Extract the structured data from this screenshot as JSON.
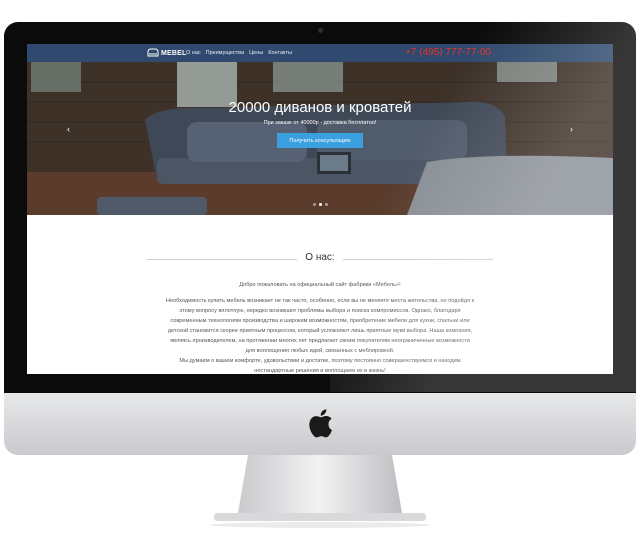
{
  "nav": {
    "brand": "MEBEL",
    "links": [
      "О нас",
      "Преимущества",
      "Цены",
      "Контакты"
    ],
    "phone": "+7 (495) 777-77-00"
  },
  "hero": {
    "title": "20000 диванов и кроватей",
    "subtitle": "При заказе от 40000р - доставка бесплатно!",
    "cta": "Получить консультацию",
    "slides_count": 3,
    "active_slide": 2
  },
  "about": {
    "title": "О нас:",
    "p1": "Добро пожаловать на официальный сайт фабрики «Мебель»!",
    "p2_lines": [
      "Необходимость купить мебель возникает не так часто, особенно, если вы не меняете места жительства, но подойдя к",
      "этому вопросу вплотную, нередко возникают проблемы выбора и поиска компромиссов. Однако, благодаря",
      "современным технологиям производства и широким возможностям, приобретение мебели для кухни, спальни или",
      "детской становится скорее приятным процессом, который усложняют лишь приятные муки выбора. Наша компания,",
      "являясь производителем, на протяжении многих лет предлагает своим покупателям неограниченные возможности",
      "для воплощения любых идей, связанных с меблировкой."
    ],
    "p3_lines": [
      "Мы думаем о вашем комфорте, удовольствии и достатке, поэтому постоянно совершенствуемся и находим",
      "нестандартные решения и воплощаем их в жизнь!"
    ]
  },
  "colors": {
    "nav_bg": "#2f4a6e",
    "phone": "#e0352b",
    "cta_bg": "#3aa0e0"
  }
}
